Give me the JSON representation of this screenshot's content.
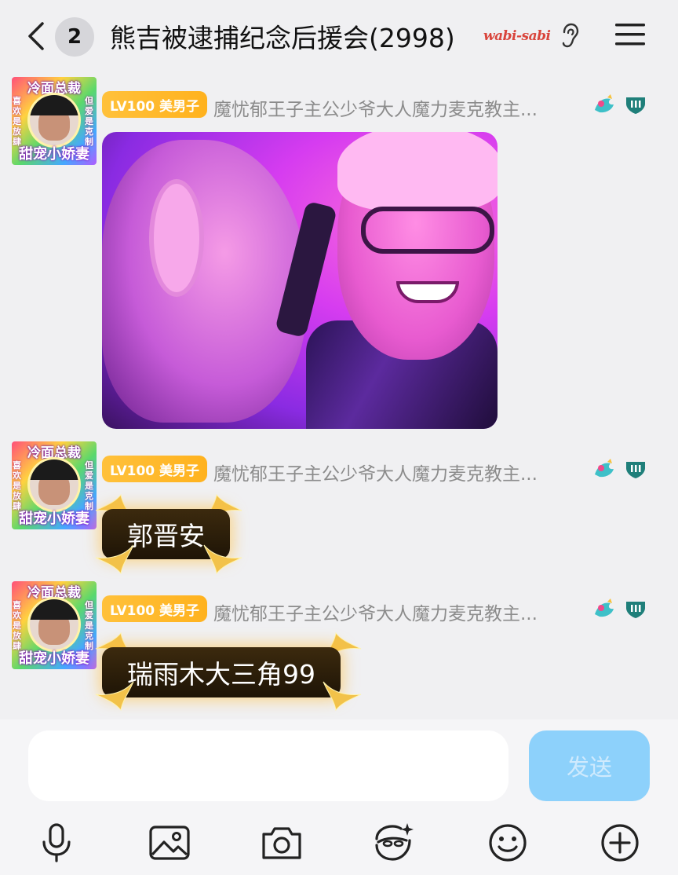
{
  "header": {
    "unread_count": "2",
    "title": "熊吉被逮捕纪念后援会(2998)",
    "tag": "wabi-sabi"
  },
  "avatar": {
    "frame_top": "冷面总裁",
    "frame_left": "喜欢是放肆",
    "frame_right": "但爱是克制",
    "frame_bottom": "甜宠小娇妻"
  },
  "messages": [
    {
      "level": "LV100 美男子",
      "sender": "魔忧郁王子主公少爷大人魔力麦克教主...",
      "type": "image"
    },
    {
      "level": "LV100 美男子",
      "sender": "魔忧郁王子主公少爷大人魔力麦克教主...",
      "type": "text",
      "text": "郭晋安"
    },
    {
      "level": "LV100 美男子",
      "sender": "魔忧郁王子主公少爷大人魔力麦克教主...",
      "type": "text",
      "text": "瑞雨木大三角99"
    }
  ],
  "composer": {
    "input_value": "",
    "send_label": "发送"
  },
  "toolbar": [
    "microphone-icon",
    "image-icon",
    "camera-icon",
    "emoji-sticker-icon",
    "smiley-icon",
    "plus-icon"
  ],
  "colors": {
    "accent": "#8dd1fb",
    "level_badge": "#ffb21e",
    "background": "#f0f0f2"
  }
}
